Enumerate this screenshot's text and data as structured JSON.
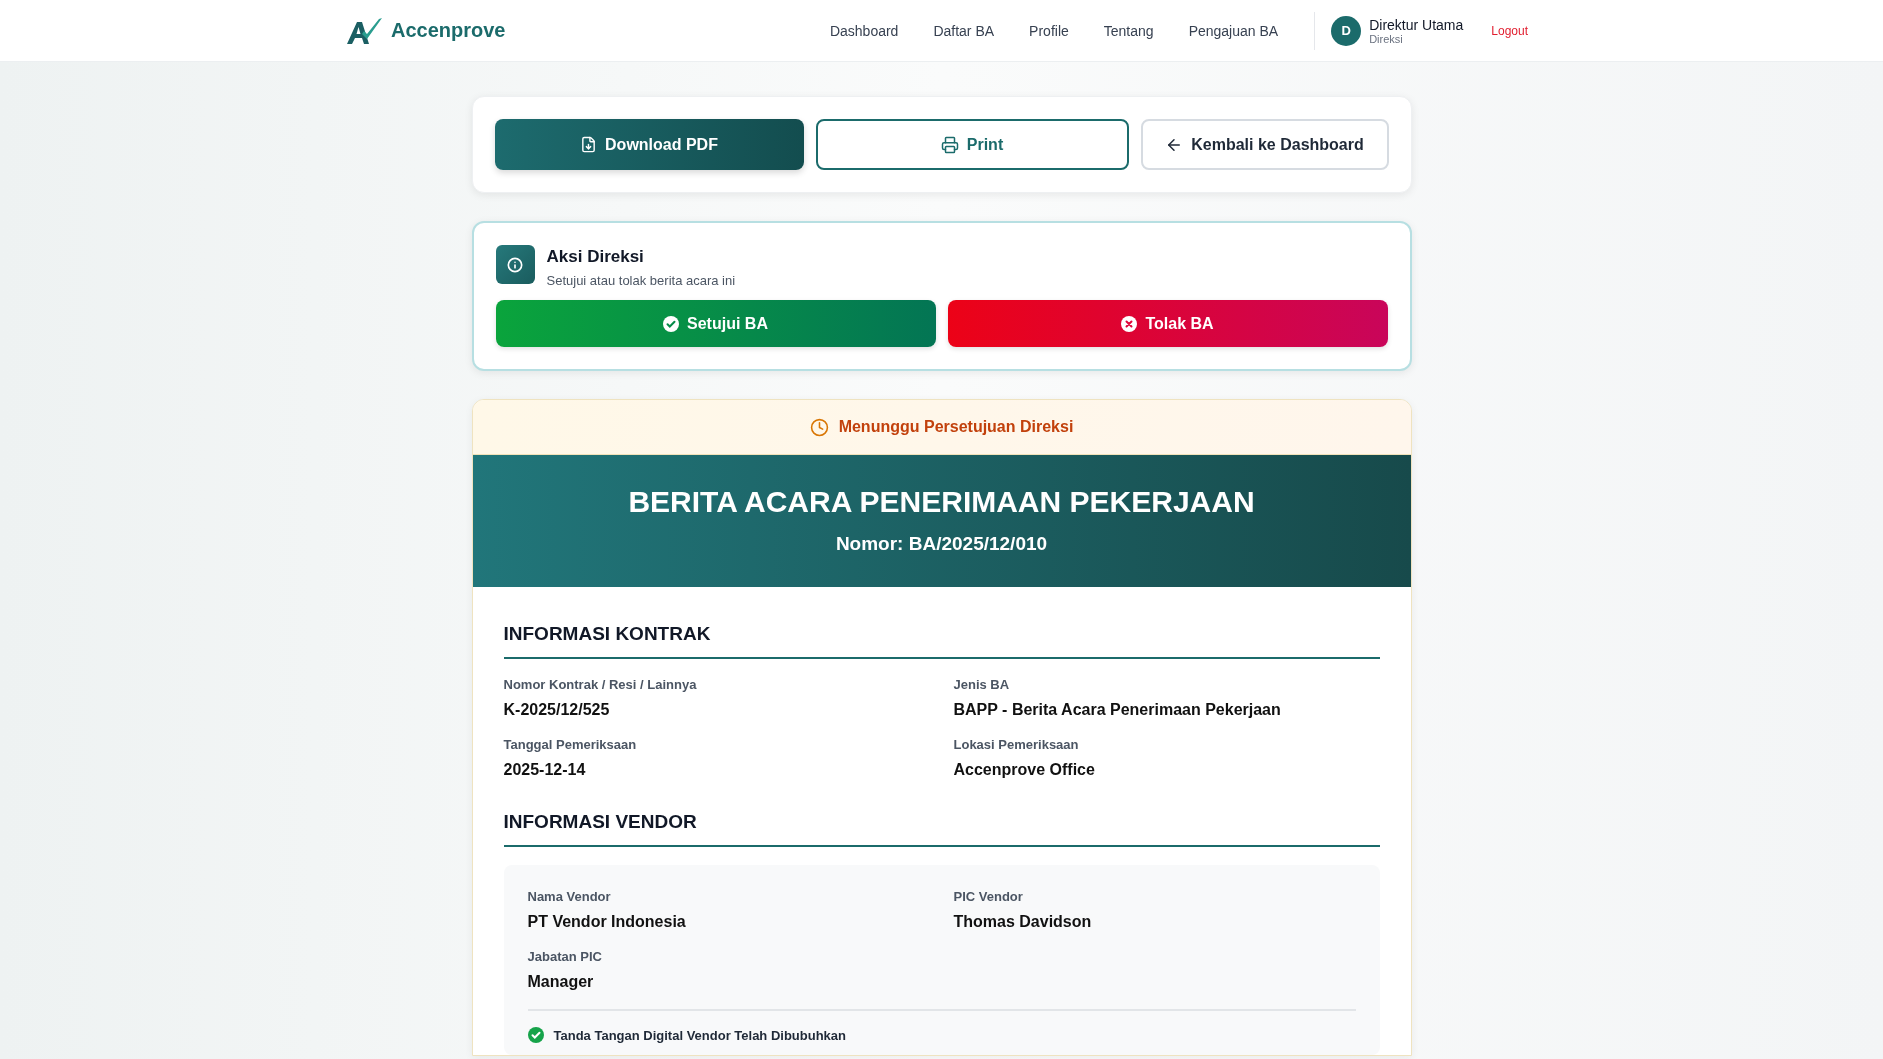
{
  "navbar": {
    "brand": "Accenprove",
    "links": [
      "Dashboard",
      "Daftar BA",
      "Profile",
      "Tentang",
      "Pengajuan BA"
    ],
    "user": {
      "initial": "D",
      "name": "Direktur Utama",
      "role": "Direksi"
    },
    "logout": "Logout"
  },
  "toolbar": [
    {
      "kind": "primary",
      "label": "Download PDF"
    },
    {
      "kind": "outline",
      "label": "Print"
    },
    {
      "kind": "secondary",
      "label": "Kembali ke Dashboard"
    }
  ],
  "action_panel": {
    "title": "Aksi Direksi",
    "subtitle": "Setujui atau tolak berita acara ini",
    "buttons": [
      {
        "kind": "approve",
        "label": "Setujui BA"
      },
      {
        "kind": "reject",
        "label": "Tolak BA"
      }
    ]
  },
  "status_banner": "Menunggu Persetujuan Direksi",
  "document": {
    "title": "BERITA ACARA PENERIMAAN PEKERJAAN",
    "number": "Nomor: BA/2025/12/010",
    "sections": [
      {
        "heading": "INFORMASI KONTRAK",
        "boxed": false,
        "fields": [
          {
            "label": "Nomor Kontrak / Resi / Lainnya",
            "value": "K-2025/12/525"
          },
          {
            "label": "Jenis BA",
            "value": "BAPP - Berita Acara Penerimaan Pekerjaan"
          },
          {
            "label": "Tanggal Pemeriksaan",
            "value": "2025-12-14"
          },
          {
            "label": "Lokasi Pemeriksaan",
            "value": "Accenprove Office"
          }
        ]
      },
      {
        "heading": "INFORMASI VENDOR",
        "boxed": true,
        "fields": [
          {
            "label": "Nama Vendor",
            "value": "PT Vendor Indonesia"
          },
          {
            "label": "PIC Vendor",
            "value": "Thomas Davidson"
          },
          {
            "label": "Jabatan PIC",
            "value": "Manager"
          }
        ],
        "signature": "Tanda Tangan Digital Vendor Telah Dibubuhkan"
      }
    ]
  }
}
